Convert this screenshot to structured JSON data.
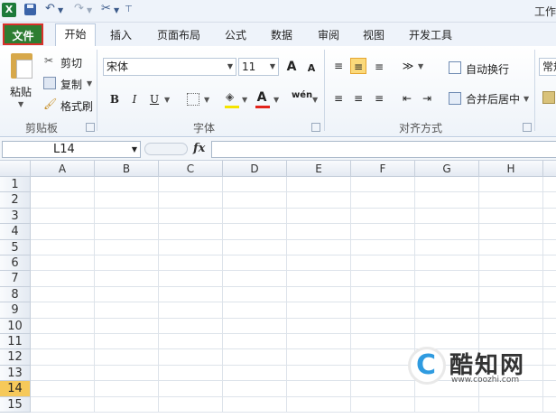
{
  "app": {
    "logo_letter": "X",
    "title_partial": "工作"
  },
  "quick_access": {
    "icons": [
      "excel-logo-icon",
      "save-icon",
      "undo-icon",
      "redo-icon",
      "customize-icon"
    ]
  },
  "tabs": [
    {
      "label": "文件",
      "name": "tab-file"
    },
    {
      "label": "开始",
      "name": "tab-home"
    },
    {
      "label": "插入",
      "name": "tab-insert"
    },
    {
      "label": "页面布局",
      "name": "tab-page-layout"
    },
    {
      "label": "公式",
      "name": "tab-formulas"
    },
    {
      "label": "数据",
      "name": "tab-data"
    },
    {
      "label": "审阅",
      "name": "tab-review"
    },
    {
      "label": "视图",
      "name": "tab-view"
    },
    {
      "label": "开发工具",
      "name": "tab-developer"
    }
  ],
  "ribbon": {
    "clipboard": {
      "paste": "粘贴",
      "cut": "剪切",
      "copy": "复制",
      "format_painter": "格式刷",
      "group": "剪贴板"
    },
    "font": {
      "font_name": "宋体",
      "font_size": "11",
      "grow": "A",
      "shrink": "A",
      "bold": "B",
      "italic": "I",
      "underline": "U",
      "color_a": "A",
      "phonetic": "wén",
      "group": "字体"
    },
    "alignment": {
      "wrap": "自动换行",
      "merge": "合并后居中",
      "group": "对齐方式"
    },
    "number": {
      "format_partial": "常规"
    }
  },
  "formula_bar": {
    "name_box": "L14",
    "fx": "fx",
    "value": ""
  },
  "grid": {
    "columns": [
      "A",
      "B",
      "C",
      "D",
      "E",
      "F",
      "G",
      "H"
    ],
    "rows": [
      "1",
      "2",
      "3",
      "4",
      "5",
      "6",
      "7",
      "8",
      "9",
      "10",
      "11",
      "12",
      "13",
      "14",
      "15"
    ],
    "active_row": "14",
    "active_cell": "L14"
  },
  "watermark": {
    "name": "酷知网",
    "url": "www.coozhi.com"
  },
  "colors": {
    "file_tab": "#2e7d32",
    "file_highlight": "#d9302a",
    "active_row": "#f6c95a",
    "accent": "#3a63a8"
  }
}
